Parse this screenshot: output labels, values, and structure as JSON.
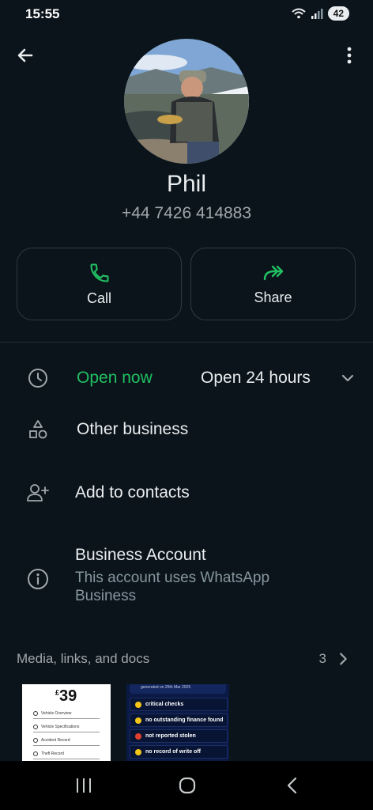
{
  "status": {
    "time": "15:55",
    "battery": "42"
  },
  "contact": {
    "name": "Phil",
    "phone": "+44 7426 414883"
  },
  "actions": [
    {
      "label": "Call",
      "icon": "phone-icon"
    },
    {
      "label": "Share",
      "icon": "share-forward-icon"
    }
  ],
  "hours": {
    "status": "Open now",
    "detail": "Open 24 hours"
  },
  "category": "Other business",
  "add_contact": "Add to contacts",
  "business": {
    "title": "Business Account",
    "subtitle": "This account uses WhatsApp Business"
  },
  "media": {
    "label": "Media, links, and docs",
    "count": "3"
  },
  "thumb1": {
    "price": "39",
    "currency": "£",
    "items": [
      "Vehicle Overview",
      "Vehicle Specifications",
      "Accident Record",
      "Theft Record"
    ]
  },
  "thumb2": {
    "header": "generated on 25th Mar 2025",
    "items": [
      "critical checks",
      "no outstanding finance found",
      "not reported stolen",
      "no record of write off"
    ]
  },
  "colors": {
    "background": "#0b141a",
    "accent_green": "#21c063",
    "text_secondary": "#8696a0"
  }
}
